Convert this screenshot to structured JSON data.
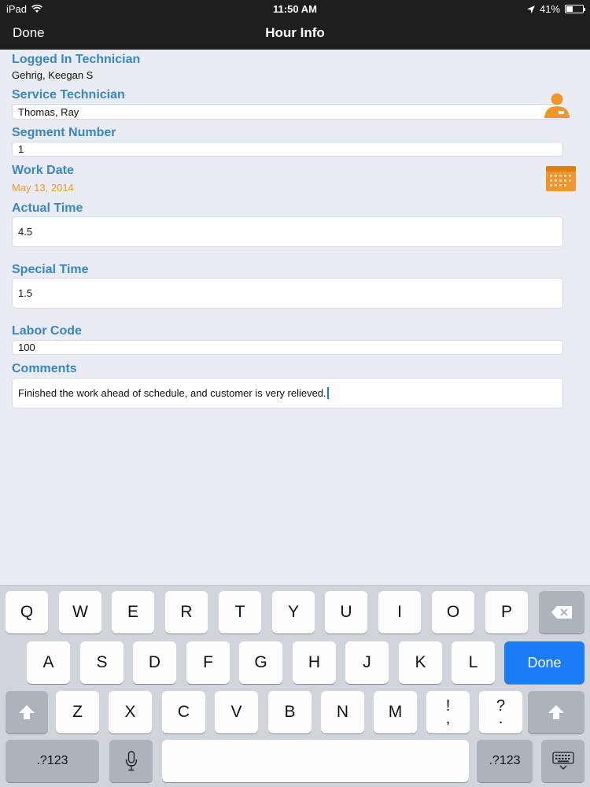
{
  "status_bar": {
    "device": "iPad",
    "time": "11:50 AM",
    "battery": "41%",
    "battery_level": 0.41
  },
  "nav": {
    "done_label": "Done",
    "title": "Hour Info"
  },
  "form": {
    "logged_in_technician": {
      "label": "Logged In Technician",
      "value": "Gehrig, Keegan S"
    },
    "service_technician": {
      "label": "Service Technician",
      "value": "Thomas, Ray"
    },
    "segment_number": {
      "label": "Segment Number",
      "value": "1"
    },
    "work_date": {
      "label": "Work Date",
      "value": "May 13, 2014"
    },
    "actual_time": {
      "label": "Actual Time",
      "value": "4.5"
    },
    "special_time": {
      "label": "Special Time",
      "value": "1.5"
    },
    "labor_code": {
      "label": "Labor Code",
      "value": "100"
    },
    "comments": {
      "label": "Comments",
      "value": "Finished the work ahead of schedule, and customer is very relieved."
    }
  },
  "icons": {
    "technician": "person-icon",
    "calendar": "calendar-icon",
    "wifi": "wifi-icon",
    "location": "location-arrow-icon",
    "backspace": "backspace-icon",
    "shift": "shift-icon",
    "mic": "microphone-icon",
    "hide_keyboard": "keyboard-hide-icon"
  },
  "colors": {
    "label_blue": "#3a86c4",
    "accent_orange": "#f0962c",
    "done_blue": "#1a7cf6",
    "bar": "#1e1e1e"
  },
  "keyboard": {
    "row1": [
      "Q",
      "W",
      "E",
      "R",
      "T",
      "Y",
      "U",
      "I",
      "O",
      "P"
    ],
    "row2": [
      "A",
      "S",
      "D",
      "F",
      "G",
      "H",
      "J",
      "K",
      "L"
    ],
    "row3": [
      "Z",
      "X",
      "C",
      "V",
      "B",
      "N",
      "M"
    ],
    "punct1": {
      "top": "!",
      "bottom": ","
    },
    "punct2": {
      "top": "?",
      "bottom": "."
    },
    "done_label": "Done",
    "numbers_label": ".?123"
  }
}
